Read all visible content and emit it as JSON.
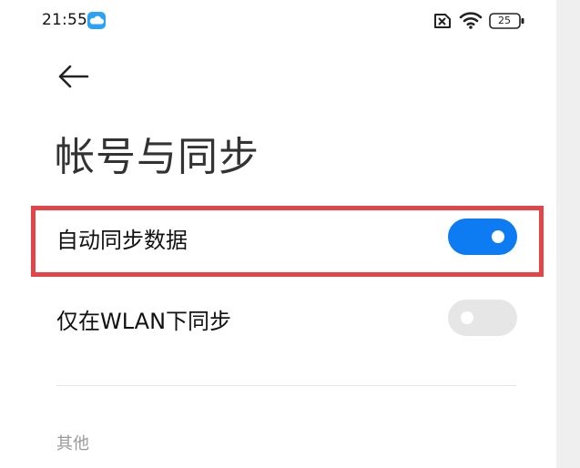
{
  "status_bar": {
    "time": "21:55",
    "battery_level": "25"
  },
  "header": {
    "title": "帐号与同步"
  },
  "settings": [
    {
      "label": "自动同步数据",
      "enabled": true
    },
    {
      "label": "仅在WLAN下同步",
      "enabled": false
    }
  ],
  "sections": {
    "other_header": "其他"
  },
  "colors": {
    "toggle_on": "#0d7cf2",
    "toggle_off": "#e6e6e6",
    "highlight": "#e34547",
    "cloud_app": "#2aa3f5"
  },
  "icons": [
    "cloud-app-icon",
    "sim-no-service-icon",
    "wifi-icon",
    "battery-icon",
    "back-arrow-icon"
  ]
}
